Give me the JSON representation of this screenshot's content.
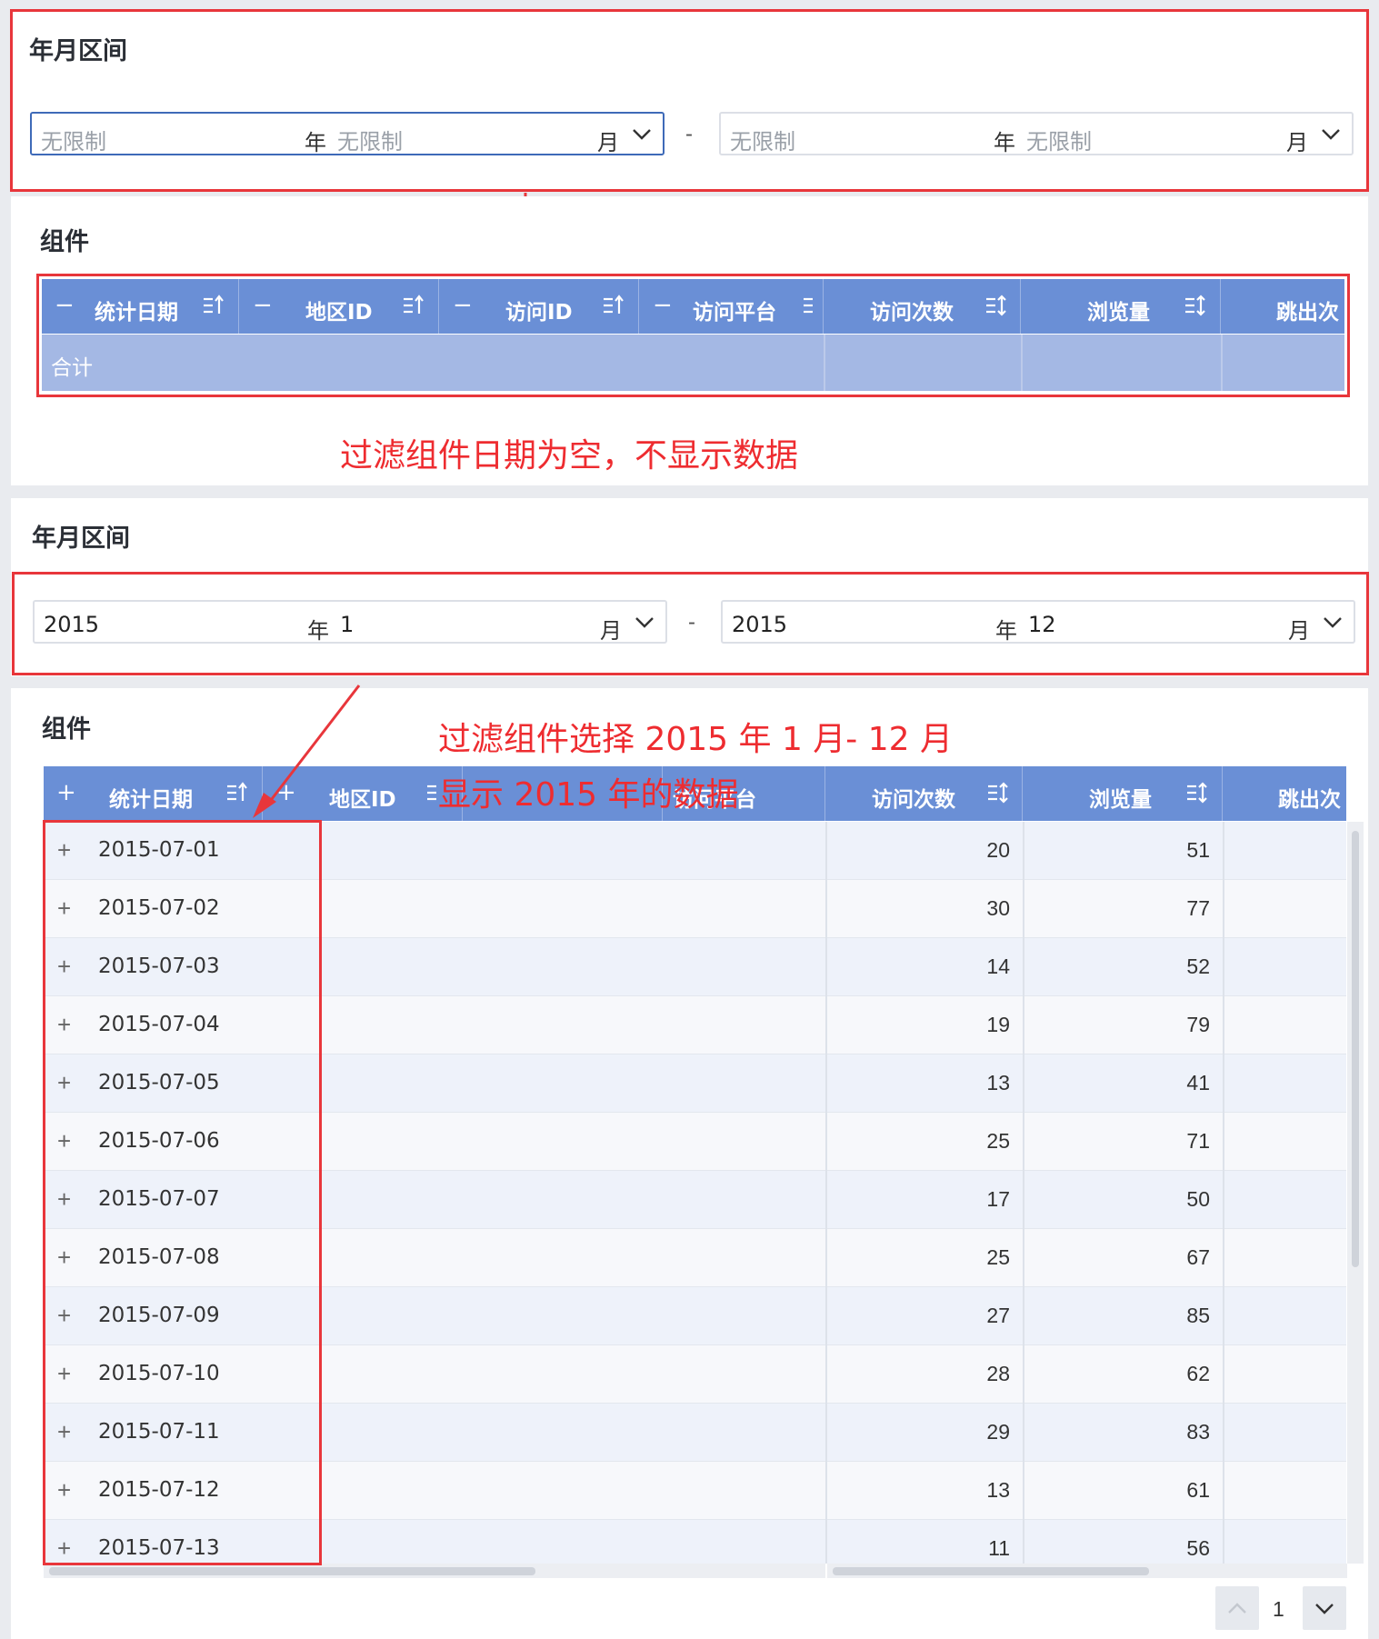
{
  "section1": {
    "title": "年月区间",
    "range_start": {
      "year": "无限制",
      "year_unit": "年",
      "month": "无限制",
      "month_unit": "月"
    },
    "separator": "-",
    "range_end": {
      "year": "无限制",
      "year_unit": "年",
      "month": "无限制",
      "month_unit": "月"
    }
  },
  "component1": {
    "title": "组件",
    "headers": [
      "统计日期",
      "地区ID",
      "访问ID",
      "访问平台",
      "访问次数",
      "浏览量",
      "跳出次"
    ],
    "expand_symbol": "−",
    "total_label": "合计",
    "annotation": "过滤组件日期为空，不显示数据"
  },
  "section2": {
    "title": "年月区间",
    "range_start": {
      "year": "2015",
      "year_unit": "年",
      "month": "1",
      "month_unit": "月"
    },
    "separator": "-",
    "range_end": {
      "year": "2015",
      "year_unit": "年",
      "month": "12",
      "month_unit": "月"
    }
  },
  "component2": {
    "title": "组件",
    "headers": [
      "统计日期",
      "地区ID",
      "访问平台",
      "访问次数",
      "浏览量",
      "跳出次"
    ],
    "expand_symbol": "+",
    "annotation_1": "过滤组件选择 2015 年 1 月- 12 月",
    "annotation_2": "显示 2015 年的数据",
    "rows": [
      {
        "date": "2015-07-01",
        "visits": "20",
        "views": "51"
      },
      {
        "date": "2015-07-02",
        "visits": "30",
        "views": "77"
      },
      {
        "date": "2015-07-03",
        "visits": "14",
        "views": "52"
      },
      {
        "date": "2015-07-04",
        "visits": "19",
        "views": "79"
      },
      {
        "date": "2015-07-05",
        "visits": "13",
        "views": "41"
      },
      {
        "date": "2015-07-06",
        "visits": "25",
        "views": "71"
      },
      {
        "date": "2015-07-07",
        "visits": "17",
        "views": "50"
      },
      {
        "date": "2015-07-08",
        "visits": "25",
        "views": "67"
      },
      {
        "date": "2015-07-09",
        "visits": "27",
        "views": "85"
      },
      {
        "date": "2015-07-10",
        "visits": "28",
        "views": "62"
      },
      {
        "date": "2015-07-11",
        "visits": "29",
        "views": "83"
      },
      {
        "date": "2015-07-12",
        "visits": "13",
        "views": "61"
      },
      {
        "date": "2015-07-13",
        "visits": "11",
        "views": "56"
      }
    ],
    "pager": {
      "page": "1"
    }
  },
  "colors": {
    "accent": "#3e6ab8",
    "header": "#6a8fd6",
    "annotation": "#ee2c30"
  }
}
